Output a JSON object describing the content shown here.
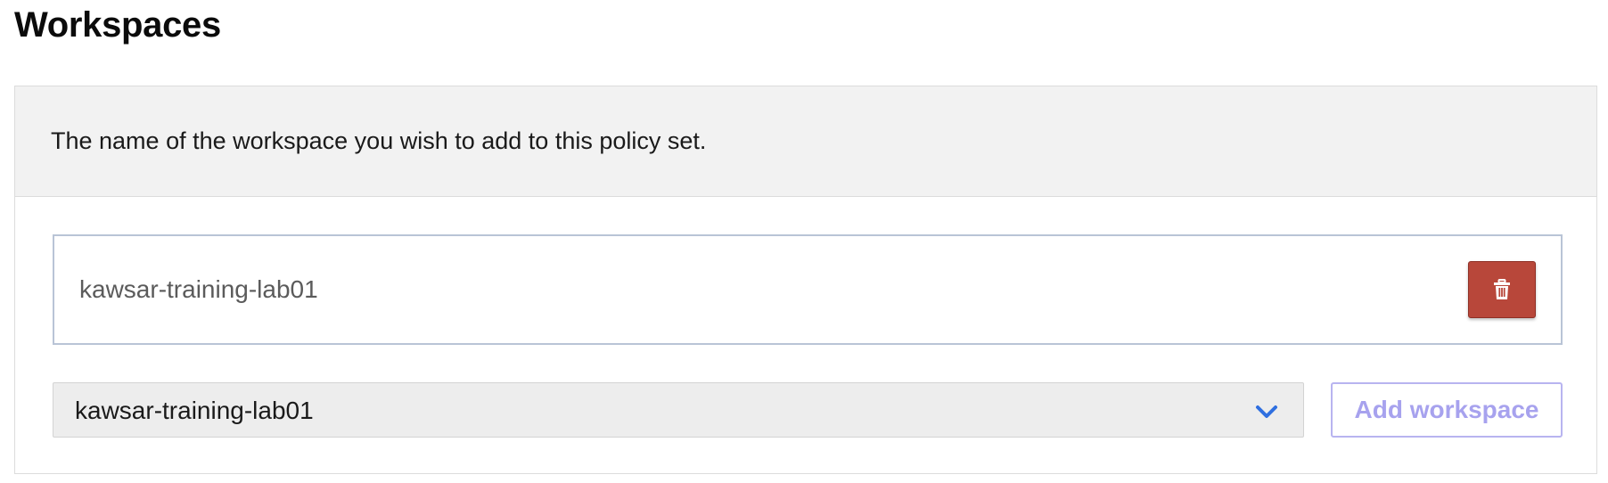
{
  "page": {
    "title": "Workspaces"
  },
  "panel": {
    "description": "The name of the workspace you wish to add to this policy set."
  },
  "workspaces": [
    {
      "name": "kawsar-training-lab01",
      "delete_icon": "trash-icon"
    }
  ],
  "select": {
    "selected_value": "kawsar-training-lab01",
    "icon": "chevron-down-icon"
  },
  "add_button": {
    "label": "Add workspace",
    "state": "disabled"
  },
  "colors": {
    "delete": "#b8473a",
    "chevron": "#2f6fe0",
    "add_disabled_text": "#a7a2ee",
    "add_disabled_border": "#b8b4f0"
  }
}
